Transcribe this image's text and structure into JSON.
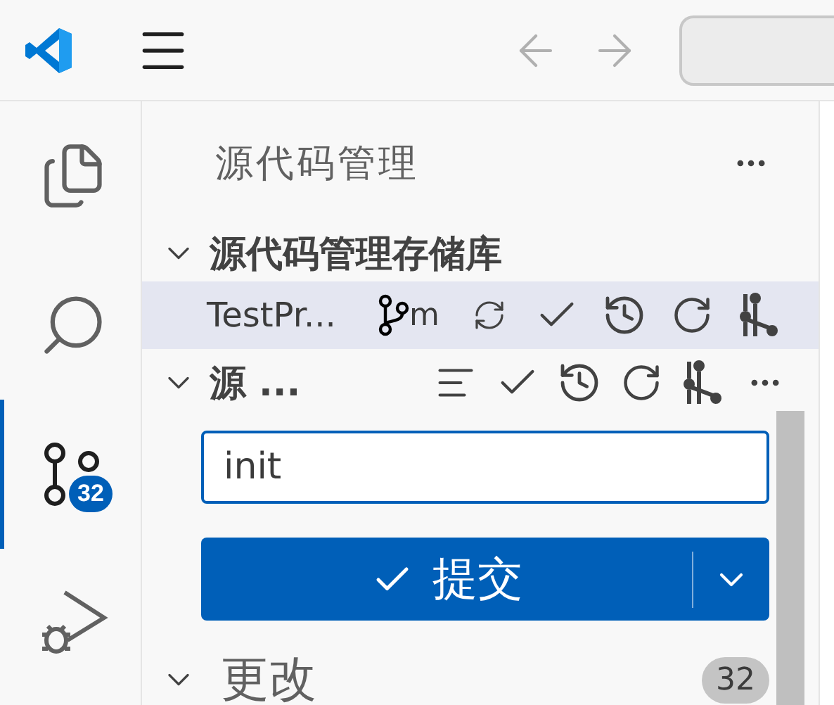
{
  "title_bar": {
    "nav": [
      {
        "kind": "back",
        "disabled": true
      },
      {
        "kind": "forward",
        "disabled": true
      }
    ]
  },
  "activity_bar": [
    {
      "kind": "explorer",
      "selected": false
    },
    {
      "kind": "search",
      "selected": false
    },
    {
      "kind": "scm",
      "selected": true,
      "badge": "32"
    },
    {
      "kind": "debug",
      "selected": false
    }
  ],
  "sidebar": {
    "title": "源代码管理",
    "repositories_section": {
      "title": "源代码管理存储库",
      "expanded": true,
      "repositories": [
        {
          "name": "TestPr...",
          "branch": "m",
          "selected": true
        }
      ]
    },
    "repo_section": {
      "title": "源 ...",
      "expanded": true
    },
    "commit_input": {
      "value": "init"
    },
    "commit_button": {
      "label": "提交"
    },
    "changes": {
      "title": "更改",
      "count": "32",
      "expanded": true
    }
  }
}
